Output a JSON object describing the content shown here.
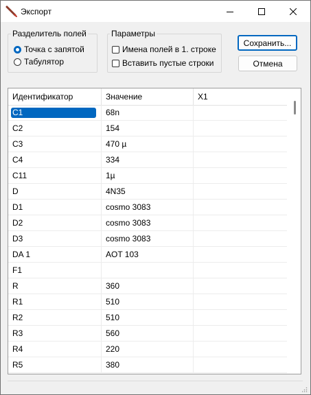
{
  "window": {
    "title": "Экспорт"
  },
  "separator_group": {
    "label": "Разделитель полей",
    "options": [
      {
        "label": "Точка с запятой",
        "selected": true
      },
      {
        "label": "Табулятор",
        "selected": false
      }
    ]
  },
  "params_group": {
    "label": "Параметры",
    "checkboxes": [
      {
        "label": "Имена полей в 1. строке",
        "checked": false
      },
      {
        "label": "Вставить пустые строки",
        "checked": false
      }
    ]
  },
  "buttons": {
    "save": "Сохранить...",
    "cancel": "Отмена"
  },
  "table": {
    "columns": [
      "Идентификатор",
      "Значение",
      "X1"
    ],
    "rows": [
      [
        "C1",
        "68n",
        ""
      ],
      [
        "C2",
        "154",
        ""
      ],
      [
        "C3",
        "470 µ",
        ""
      ],
      [
        "C4",
        "334",
        ""
      ],
      [
        "C11",
        "1µ",
        ""
      ],
      [
        "D",
        "4N35",
        ""
      ],
      [
        "D1",
        "cosmo 3083",
        ""
      ],
      [
        "D2",
        "cosmo 3083",
        ""
      ],
      [
        "D3",
        "cosmo 3083",
        ""
      ],
      [
        "DA 1",
        "AOT 103",
        ""
      ],
      [
        "F1",
        "",
        ""
      ],
      [
        "R",
        "360",
        ""
      ],
      [
        "R1",
        "510",
        ""
      ],
      [
        "R2",
        "510",
        ""
      ],
      [
        "R3",
        "560",
        ""
      ],
      [
        "R4",
        "220",
        ""
      ],
      [
        "R5",
        "380",
        ""
      ]
    ],
    "selected_row": 0
  },
  "colors": {
    "accent": "#0067c0"
  }
}
